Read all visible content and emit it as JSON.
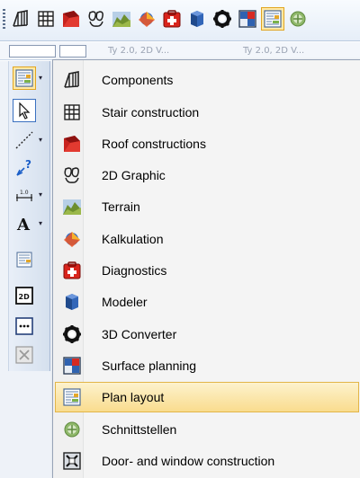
{
  "toolbar": {
    "buttons": [
      {
        "icon": "components-icon",
        "active": false
      },
      {
        "icon": "stair-icon",
        "active": false
      },
      {
        "icon": "roof-icon",
        "active": false
      },
      {
        "icon": "graphic-2d-icon",
        "active": false
      },
      {
        "icon": "terrain-icon",
        "active": false
      },
      {
        "icon": "kalkulation-icon",
        "active": false
      },
      {
        "icon": "diagnostics-icon",
        "active": false
      },
      {
        "icon": "modeler-icon",
        "active": false
      },
      {
        "icon": "converter-3d-icon",
        "active": false
      },
      {
        "icon": "surface-planning-icon",
        "active": false
      },
      {
        "icon": "plan-layout-icon",
        "active": true
      }
    ]
  },
  "tab_strip": {
    "ghost_texts": [
      "Ty 2.0, 2D V...",
      "Ty 2.0, 2D V..."
    ]
  },
  "left_toolbar": {
    "tools": [
      {
        "icon": "plan-layout-icon",
        "has_dropdown": true,
        "state": "active"
      },
      {
        "icon": "pointer-icon",
        "has_dropdown": false,
        "state": "selected"
      },
      {
        "icon": "dashed-line-icon",
        "has_dropdown": true,
        "state": "normal"
      },
      {
        "icon": "query-icon",
        "has_dropdown": false,
        "state": "normal"
      },
      {
        "icon": "dimension-icon",
        "has_dropdown": true,
        "state": "normal"
      },
      {
        "icon": "text-icon",
        "has_dropdown": true,
        "state": "normal"
      },
      {
        "icon": "plan-element-icon",
        "has_dropdown": false,
        "state": "normal"
      },
      {
        "icon": "view-2d-icon",
        "has_dropdown": false,
        "state": "normal"
      },
      {
        "icon": "more-icon",
        "has_dropdown": false,
        "state": "normal"
      },
      {
        "icon": "disabled-close-icon",
        "has_dropdown": false,
        "state": "disabled"
      }
    ]
  },
  "menu": {
    "items": [
      {
        "label": "Components",
        "icon": "components-icon",
        "highlighted": false
      },
      {
        "label": "Stair construction",
        "icon": "stair-icon",
        "highlighted": false
      },
      {
        "label": "Roof constructions",
        "icon": "roof-icon",
        "highlighted": false
      },
      {
        "label": "2D Graphic",
        "icon": "graphic-2d-icon",
        "highlighted": false
      },
      {
        "label": "Terrain",
        "icon": "terrain-icon",
        "highlighted": false
      },
      {
        "label": "Kalkulation",
        "icon": "kalkulation-icon",
        "highlighted": false
      },
      {
        "label": "Diagnostics",
        "icon": "diagnostics-icon",
        "highlighted": false
      },
      {
        "label": "Modeler",
        "icon": "modeler-icon",
        "highlighted": false
      },
      {
        "label": "3D Converter",
        "icon": "converter-3d-icon",
        "highlighted": false
      },
      {
        "label": "Surface planning",
        "icon": "surface-planning-icon",
        "highlighted": false
      },
      {
        "label": "Plan layout",
        "icon": "plan-layout-icon",
        "highlighted": true
      },
      {
        "label": "Schnittstellen",
        "icon": "schnittstellen-icon",
        "highlighted": false
      },
      {
        "label": "Door- and window construction",
        "icon": "door-window-icon",
        "highlighted": false
      }
    ]
  },
  "colors": {
    "highlight_fill": "#f9dc8e",
    "highlight_border": "#e2b548",
    "toolbar_bg": "#e6eef8",
    "menu_bg": "#f4f4f4"
  }
}
